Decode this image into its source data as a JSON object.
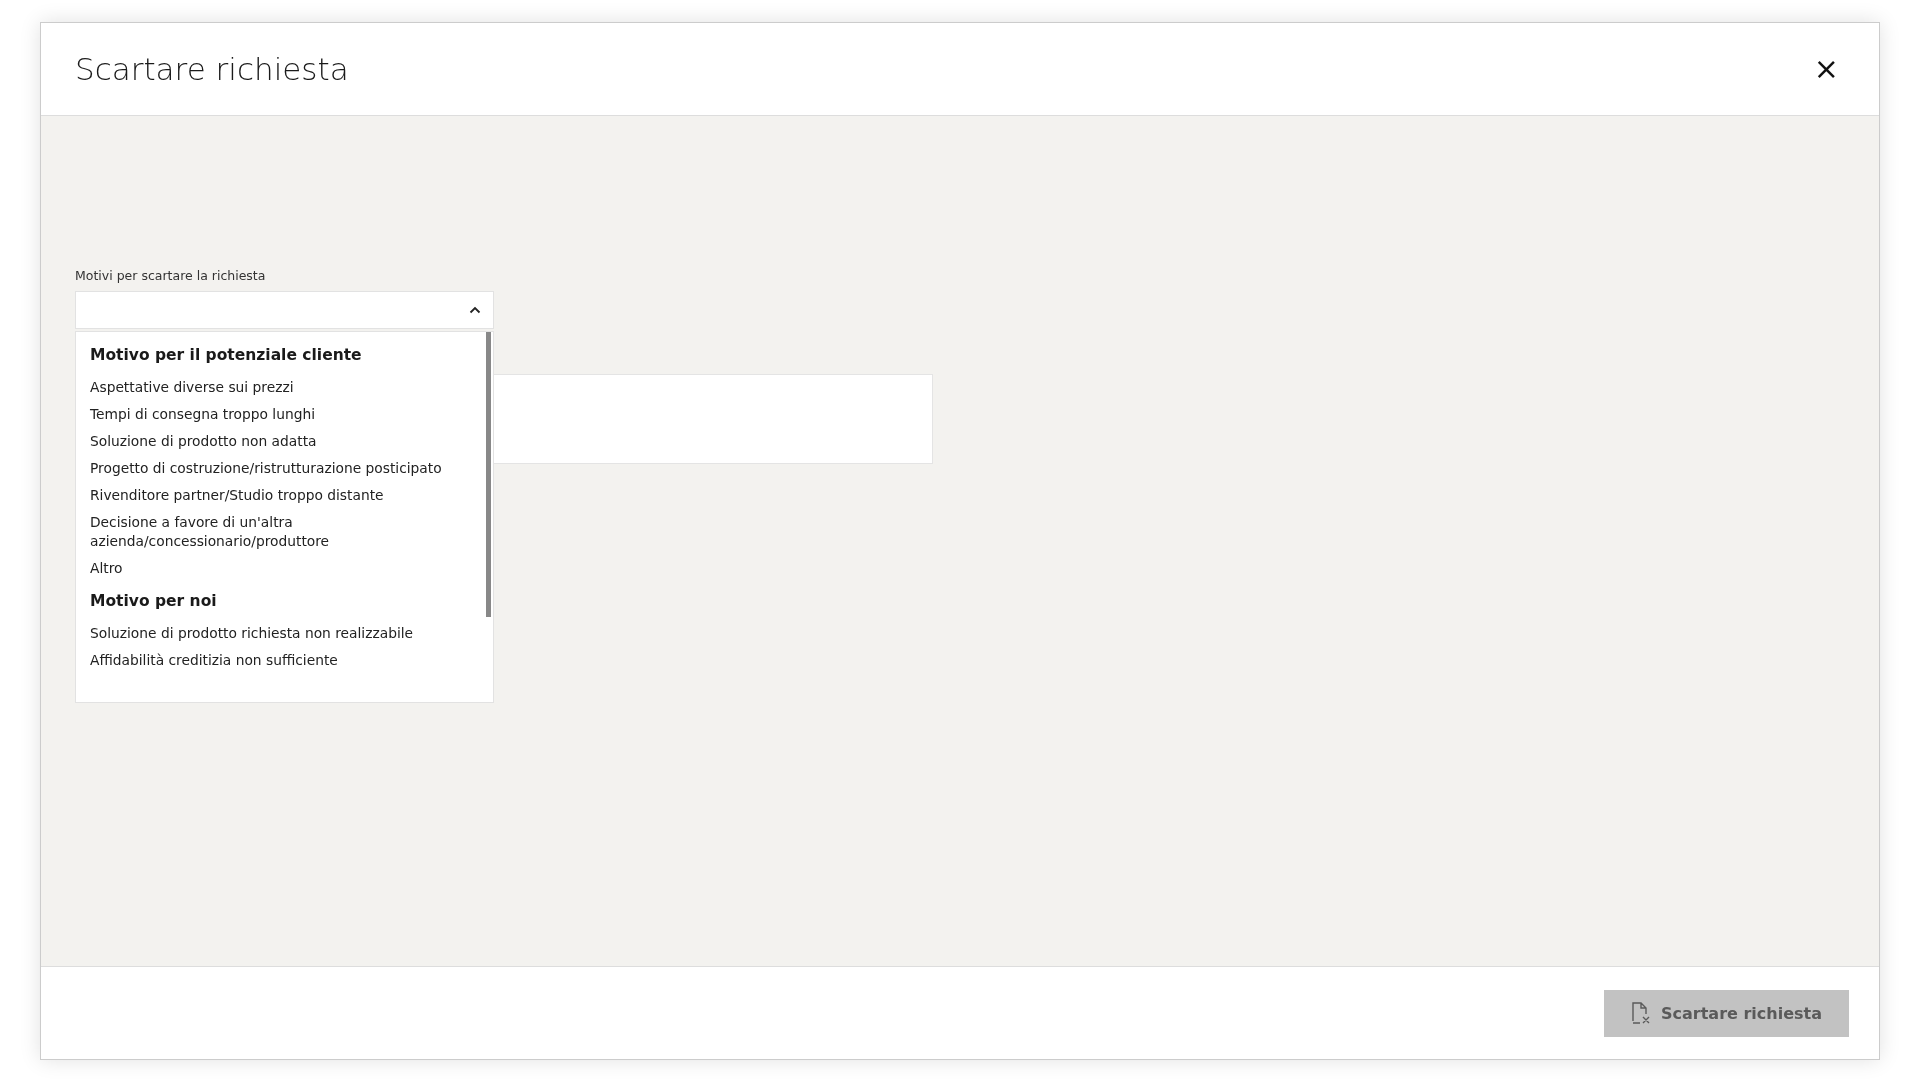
{
  "dialog": {
    "title": "Scartare richiesta",
    "close_icon": "×"
  },
  "reason_select": {
    "label": "Motivi per scartare la richiesta",
    "expanded": true,
    "options": [
      {
        "kind": "header",
        "text": "Motivo per il potenziale cliente"
      },
      {
        "kind": "option",
        "text": "Aspettative diverse sui prezzi"
      },
      {
        "kind": "option",
        "text": "Tempi di consegna troppo lunghi"
      },
      {
        "kind": "option",
        "text": "Soluzione di prodotto non adatta"
      },
      {
        "kind": "option",
        "text": "Progetto di costruzione/ristrutturazione posticipato"
      },
      {
        "kind": "option",
        "text": "Rivenditore partner/Studio troppo distante"
      },
      {
        "kind": "option",
        "text": "Decisione a favore di un'altra azienda/concessionario/produttore"
      },
      {
        "kind": "option",
        "text": "Altro"
      },
      {
        "kind": "header",
        "text": "Motivo per noi"
      },
      {
        "kind": "option",
        "text": "Soluzione di prodotto richiesta non realizzabile"
      },
      {
        "kind": "option",
        "text": "Affidabilità creditizia non sufficiente"
      }
    ]
  },
  "submit_button": {
    "label": "Scartare richiesta",
    "disabled": true
  }
}
